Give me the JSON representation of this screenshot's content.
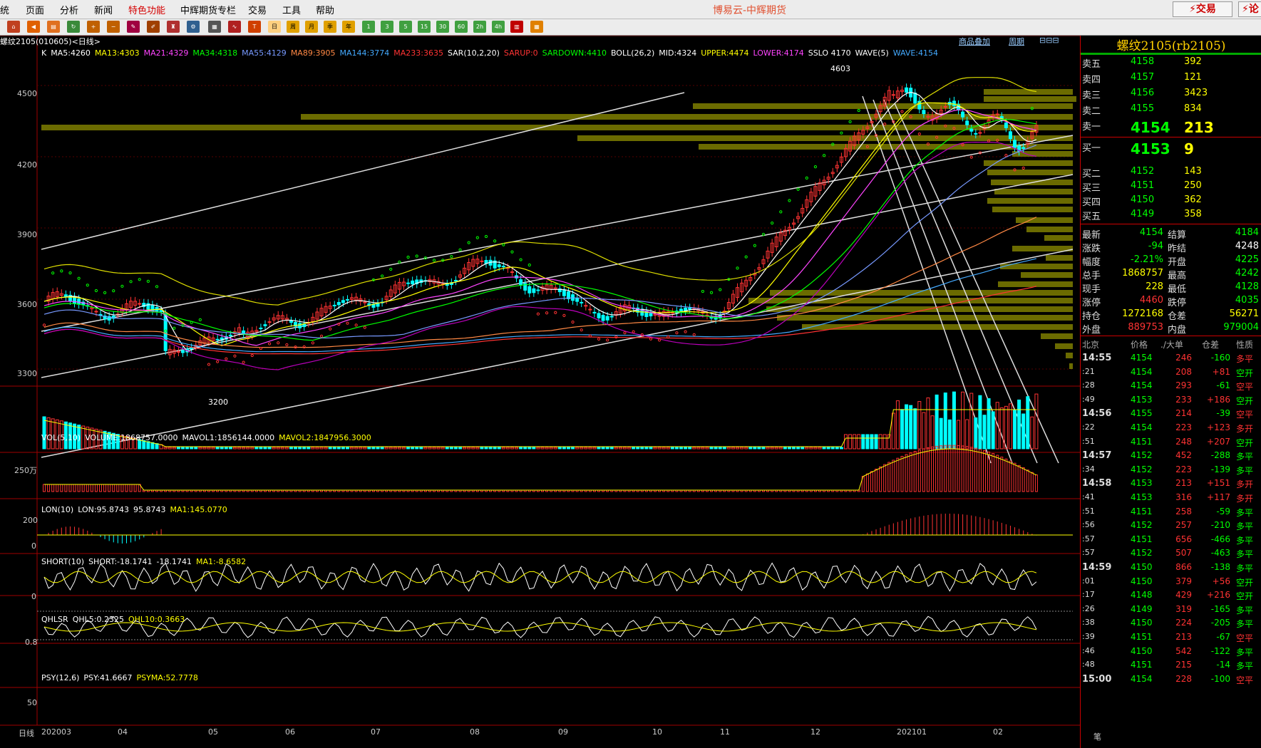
{
  "menu": {
    "items": [
      "统",
      "页面",
      "分析",
      "新闻",
      "特色功能",
      "中辉期货专栏",
      "交易",
      "工具",
      "帮助"
    ],
    "app_title": "博易云-中辉期货",
    "trade_label": "交易",
    "trade_label2": "论"
  },
  "toolbar": {
    "period_buttons": [
      "日",
      "周",
      "月",
      "季",
      "年",
      "1",
      "3",
      "5",
      "15",
      "30",
      "60",
      "2h",
      "4h"
    ]
  },
  "chart": {
    "instrument_label": "螺纹2105(010605)<日线>",
    "add_product": "商品叠加",
    "period_label": "周期",
    "main_legend": [
      {
        "text": "K",
        "color": "#ffffff"
      },
      {
        "text": "MA5:4260",
        "color": "#ffffff"
      },
      {
        "text": "MA13:4303",
        "color": "#ffff00"
      },
      {
        "text": "MA21:4329",
        "color": "#ff44ff"
      },
      {
        "text": "MA34:4318",
        "color": "#00ff00"
      },
      {
        "text": "MA55:4129",
        "color": "#7799ff"
      },
      {
        "text": "MA89:3905",
        "color": "#ff8844"
      },
      {
        "text": "MA144:3774",
        "color": "#44aaff"
      },
      {
        "text": "MA233:3635",
        "color": "#ff3333"
      },
      {
        "text": "SAR(10,2,20)",
        "color": "#ffffff"
      },
      {
        "text": "SARUP:0",
        "color": "#ff3333"
      },
      {
        "text": "SARDOWN:4410",
        "color": "#00ff00"
      },
      {
        "text": "BOLL(26,2)",
        "color": "#ffffff"
      },
      {
        "text": "MID:4324",
        "color": "#ffffff"
      },
      {
        "text": "UPPER:4474",
        "color": "#ffff00"
      },
      {
        "text": "LOWER:4174",
        "color": "#ff44ff"
      },
      {
        "text": "SSLO 4170",
        "color": "#ffffff"
      },
      {
        "text": "WAVE(5)",
        "color": "#ffffff"
      },
      {
        "text": "WAVE:4154",
        "color": "#44aaff"
      }
    ],
    "y_ticks": [
      "4500",
      "4200",
      "3900",
      "3600",
      "3300"
    ],
    "high_label": "4603",
    "low_label": "3200",
    "vol_legend": [
      {
        "text": "VOL(5,10)",
        "color": "#ffffff"
      },
      {
        "text": "VOLUME:1868757.0000",
        "color": "#ffffff"
      },
      {
        "text": "MAVOL1:1856144.0000",
        "color": "#ffffff"
      },
      {
        "text": "MAVOL2:1847956.3000",
        "color": "#ffff00"
      }
    ],
    "vol_tick": "250万",
    "lon_legend": [
      {
        "text": "LON(10)",
        "color": "#ffffff"
      },
      {
        "text": "LON:95.8743",
        "color": "#ffffff"
      },
      {
        "text": "95.8743",
        "color": "#ffffff"
      },
      {
        "text": "MA1:145.0770",
        "color": "#ffff00"
      }
    ],
    "lon_ticks": [
      "200",
      "0"
    ],
    "short_legend": [
      {
        "text": "SHORT(10)",
        "color": "#ffffff"
      },
      {
        "text": "SHORT:-18.1741",
        "color": "#ffffff"
      },
      {
        "text": "-18.1741",
        "color": "#ffffff"
      },
      {
        "text": "MA1:-8.6582",
        "color": "#ffff00"
      }
    ],
    "short_tick": "0",
    "qhl_legend": [
      {
        "text": "QHLSR",
        "color": "#ffffff"
      },
      {
        "text": "QHL5:0.2325",
        "color": "#ffffff"
      },
      {
        "text": "QHL10:0.3663",
        "color": "#ffff00"
      }
    ],
    "qhl_tick": "0.8",
    "psy_legend": [
      {
        "text": "PSY(12,6)",
        "color": "#ffffff"
      },
      {
        "text": "PSY:41.6667",
        "color": "#ffffff"
      },
      {
        "text": "PSYMA:52.7778",
        "color": "#ffff00"
      }
    ],
    "psy_tick": "50",
    "x_axis": [
      "日线",
      "202003",
      "04",
      "05",
      "06",
      "07",
      "08",
      "09",
      "10",
      "11",
      "12",
      "202101",
      "02"
    ]
  },
  "quote": {
    "title": "螺纹2105(rb2105)",
    "asks": [
      {
        "label": "卖五",
        "price": "4158",
        "vol": "392"
      },
      {
        "label": "卖四",
        "price": "4157",
        "vol": "121"
      },
      {
        "label": "卖三",
        "price": "4156",
        "vol": "3423"
      },
      {
        "label": "卖二",
        "price": "4155",
        "vol": "834"
      },
      {
        "label": "卖一",
        "price": "4154",
        "vol": "213"
      }
    ],
    "bids": [
      {
        "label": "买一",
        "price": "4153",
        "vol": "9"
      },
      {
        "label": "买二",
        "price": "4152",
        "vol": "143"
      },
      {
        "label": "买三",
        "price": "4151",
        "vol": "250"
      },
      {
        "label": "买四",
        "price": "4150",
        "vol": "362"
      },
      {
        "label": "买五",
        "price": "4149",
        "vol": "358"
      }
    ],
    "stats": [
      {
        "l1": "最新",
        "v1": "4154",
        "c1": "#00ff00",
        "l2": "结算",
        "v2": "4184",
        "c2": "#00ff00"
      },
      {
        "l1": "涨跌",
        "v1": "-94",
        "c1": "#00ff00",
        "l2": "昨结",
        "v2": "4248",
        "c2": "#ffffff"
      },
      {
        "l1": "幅度",
        "v1": "-2.21%",
        "c1": "#00ff00",
        "l2": "开盘",
        "v2": "4225",
        "c2": "#00ff00"
      },
      {
        "l1": "总手",
        "v1": "1868757",
        "c1": "#ffff00",
        "l2": "最高",
        "v2": "4242",
        "c2": "#00ff00"
      },
      {
        "l1": "现手",
        "v1": "228",
        "c1": "#ffff00",
        "l2": "最低",
        "v2": "4128",
        "c2": "#00ff00"
      },
      {
        "l1": "涨停",
        "v1": "4460",
        "c1": "#ff3333",
        "l2": "跌停",
        "v2": "4035",
        "c2": "#00ff00"
      },
      {
        "l1": "持仓",
        "v1": "1272168",
        "c1": "#ffff00",
        "l2": "仓差",
        "v2": "56271",
        "c2": "#ffff00"
      },
      {
        "l1": "外盘",
        "v1": "889753",
        "c1": "#ff3333",
        "l2": "内盘",
        "v2": "979004",
        "c2": "#00ff00"
      }
    ],
    "ticks_header": [
      "北京",
      "价格",
      "./大单",
      "仓差",
      "性质"
    ],
    "ticks": [
      {
        "t": "14:55",
        "p": "4154",
        "v": "246",
        "d": "-160",
        "n": "多平",
        "nc": "#ff3333"
      },
      {
        "t": ":21",
        "p": "4154",
        "v": "208",
        "d": "+81",
        "n": "空开",
        "nc": "#00ff00"
      },
      {
        "t": ":28",
        "p": "4154",
        "v": "293",
        "d": "-61",
        "n": "空平",
        "nc": "#ff3333"
      },
      {
        "t": ":49",
        "p": "4153",
        "v": "233",
        "d": "+186",
        "n": "空开",
        "nc": "#00ff00"
      },
      {
        "t": "14:56",
        "p": "4155",
        "v": "214",
        "d": "-39",
        "n": "空平",
        "nc": "#ff3333"
      },
      {
        "t": ":22",
        "p": "4154",
        "v": "223",
        "d": "+123",
        "n": "多开",
        "nc": "#ff3333"
      },
      {
        "t": ":51",
        "p": "4151",
        "v": "248",
        "d": "+207",
        "n": "空开",
        "nc": "#00ff00"
      },
      {
        "t": "14:57",
        "p": "4152",
        "v": "452",
        "d": "-288",
        "n": "多平",
        "nc": "#00ff00"
      },
      {
        "t": ":34",
        "p": "4152",
        "v": "223",
        "d": "-139",
        "n": "多平",
        "nc": "#00ff00"
      },
      {
        "t": "14:58",
        "p": "4153",
        "v": "213",
        "d": "+151",
        "n": "多开",
        "nc": "#ff3333"
      },
      {
        "t": ":41",
        "p": "4153",
        "v": "316",
        "d": "+117",
        "n": "多开",
        "nc": "#ff3333"
      },
      {
        "t": ":51",
        "p": "4151",
        "v": "258",
        "d": "-59",
        "n": "多平",
        "nc": "#00ff00"
      },
      {
        "t": ":56",
        "p": "4152",
        "v": "257",
        "d": "-210",
        "n": "多平",
        "nc": "#00ff00"
      },
      {
        "t": ":57",
        "p": "4151",
        "v": "656",
        "d": "-466",
        "n": "多平",
        "nc": "#00ff00"
      },
      {
        "t": ":57",
        "p": "4152",
        "v": "507",
        "d": "-463",
        "n": "多平",
        "nc": "#00ff00"
      },
      {
        "t": "14:59",
        "p": "4150",
        "v": "866",
        "d": "-138",
        "n": "多平",
        "nc": "#00ff00"
      },
      {
        "t": ":01",
        "p": "4150",
        "v": "379",
        "d": "+56",
        "n": "空开",
        "nc": "#00ff00"
      },
      {
        "t": ":17",
        "p": "4148",
        "v": "429",
        "d": "+216",
        "n": "空开",
        "nc": "#00ff00"
      },
      {
        "t": ":26",
        "p": "4149",
        "v": "319",
        "d": "-165",
        "n": "多平",
        "nc": "#00ff00"
      },
      {
        "t": ":38",
        "p": "4150",
        "v": "224",
        "d": "-205",
        "n": "多平",
        "nc": "#00ff00"
      },
      {
        "t": ":39",
        "p": "4151",
        "v": "213",
        "d": "-67",
        "n": "空平",
        "nc": "#ff3333"
      },
      {
        "t": ":46",
        "p": "4150",
        "v": "542",
        "d": "-122",
        "n": "多平",
        "nc": "#00ff00"
      },
      {
        "t": ":48",
        "p": "4151",
        "v": "215",
        "d": "-14",
        "n": "多平",
        "nc": "#00ff00"
      },
      {
        "t": "15:00",
        "p": "4154",
        "v": "228",
        "d": "-100",
        "n": "空平",
        "nc": "#ff3333"
      }
    ],
    "footer_tab": "笔"
  },
  "colors": {
    "up": "#ff3333",
    "down": "#00ffff",
    "grid": "#880000",
    "profile": "#6b6b00"
  }
}
